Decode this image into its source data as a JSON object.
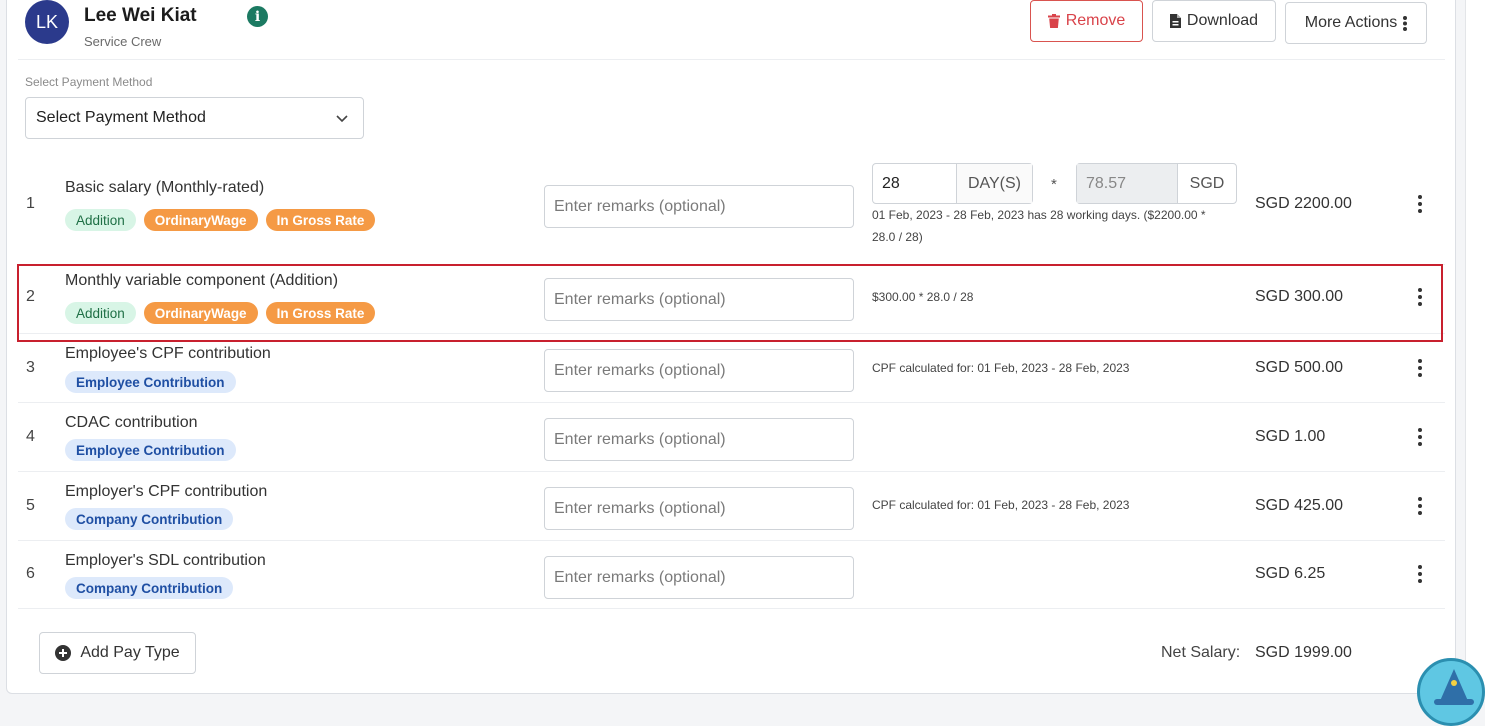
{
  "employee": {
    "initials": "LK",
    "name": "Lee Wei Kiat",
    "role": "Service Crew"
  },
  "actions": {
    "remove": "Remove",
    "download": "Download",
    "more": "More Actions"
  },
  "payment_method": {
    "label": "Select Payment Method",
    "selected": "Select Payment Method"
  },
  "remarks_placeholder": "Enter remarks (optional)",
  "basic_salary": {
    "days": "28",
    "days_unit": "DAY(S)",
    "multiplier": "*",
    "rate": "78.57",
    "rate_unit": "SGD",
    "note": "01 Feb, 2023 - 28 Feb, 2023 has 28 working days. ($2200.00 * 28.0 / 28)"
  },
  "rows": [
    {
      "num": "1",
      "title": "Basic salary (Monthly-rated)",
      "badges": [
        "Addition",
        "OrdinaryWage",
        "In Gross Rate"
      ],
      "note": "",
      "amount": "SGD 2200.00"
    },
    {
      "num": "2",
      "title": "Monthly variable component (Addition)",
      "badges": [
        "Addition",
        "OrdinaryWage",
        "In Gross Rate"
      ],
      "note": "$300.00 * 28.0 / 28",
      "amount": "SGD 300.00"
    },
    {
      "num": "3",
      "title": "Employee's CPF contribution",
      "badges": [
        "Employee Contribution"
      ],
      "note": "CPF calculated for: 01 Feb, 2023 - 28 Feb, 2023",
      "amount": "SGD 500.00"
    },
    {
      "num": "4",
      "title": "CDAC contribution",
      "badges": [
        "Employee Contribution"
      ],
      "note": "",
      "amount": "SGD 1.00"
    },
    {
      "num": "5",
      "title": "Employer's CPF contribution",
      "badges": [
        "Company Contribution"
      ],
      "note": "CPF calculated for: 01 Feb, 2023 - 28 Feb, 2023",
      "amount": "SGD 425.00"
    },
    {
      "num": "6",
      "title": "Employer's SDL contribution",
      "badges": [
        "Company Contribution"
      ],
      "note": "",
      "amount": "SGD 6.25"
    }
  ],
  "footer": {
    "add_pay_type": "Add Pay Type",
    "net_label": "Net Salary:",
    "net_value": "SGD 1999.00"
  },
  "colors": {
    "accent_red": "#d9434a",
    "badge_orange": "#f59a45",
    "badge_green_bg": "#d8f5e6",
    "badge_blue_bg": "#dde9fb",
    "avatar": "#2b3a8c",
    "highlight": "#c8202e"
  }
}
